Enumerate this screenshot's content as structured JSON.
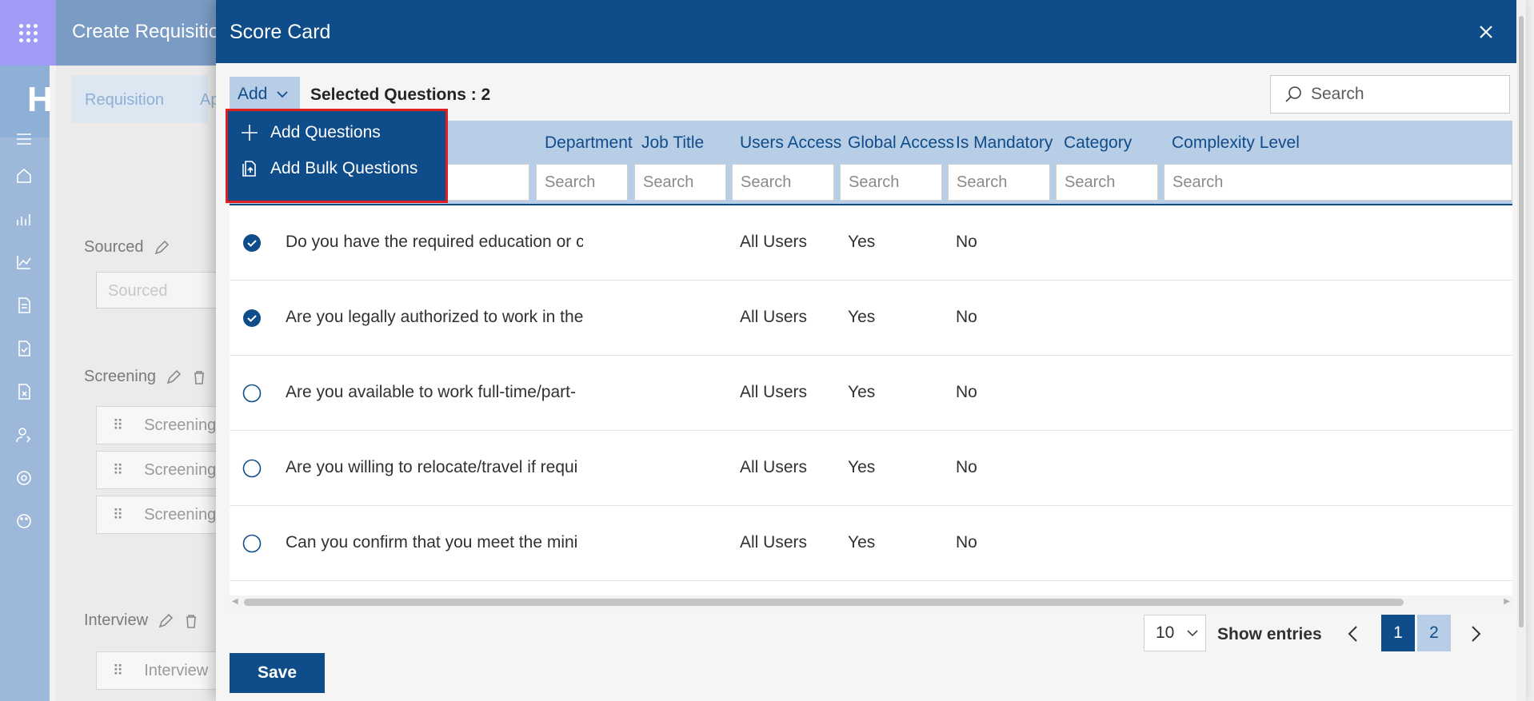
{
  "background": {
    "header_title": "Create Requisition",
    "brand_letter": "H",
    "tabs": [
      "Requisition",
      "Ap"
    ],
    "sections": {
      "sourced": {
        "label": "Sourced",
        "placeholder": "Sourced"
      },
      "screening": {
        "label": "Screening",
        "items": [
          "Screening",
          "Screening",
          "Screening"
        ]
      },
      "interview": {
        "label": "Interview",
        "items": [
          "Interview"
        ]
      }
    }
  },
  "dialog": {
    "title": "Score Card",
    "add_label": "Add",
    "selected_questions": "Selected Questions : 2",
    "search_placeholder": "Search",
    "add_menu": {
      "items": [
        {
          "label": "Add Questions",
          "icon": "plus-icon"
        },
        {
          "label": "Add Bulk Questions",
          "icon": "bulk-upload-icon"
        }
      ]
    },
    "columns": [
      {
        "label": "Department",
        "filter_placeholder": "Search"
      },
      {
        "label": "Job Title",
        "filter_placeholder": "Search"
      },
      {
        "label": "Users Access",
        "filter_placeholder": "Search"
      },
      {
        "label": "Global Access",
        "filter_placeholder": "Search"
      },
      {
        "label": "Is Mandatory",
        "filter_placeholder": "Search"
      },
      {
        "label": "Category",
        "filter_placeholder": "Search"
      },
      {
        "label": "Complexity Level",
        "filter_placeholder": "Search"
      }
    ],
    "rows": [
      {
        "question": "Do you have the required education or c",
        "users_access": "All Users",
        "global_access": "Yes",
        "is_mandatory": "No",
        "selected": true
      },
      {
        "question": "Are you legally authorized to work in the",
        "users_access": "All Users",
        "global_access": "Yes",
        "is_mandatory": "No",
        "selected": true
      },
      {
        "question": "Are you available to work full-time/part-",
        "users_access": "All Users",
        "global_access": "Yes",
        "is_mandatory": "No",
        "selected": false
      },
      {
        "question": "Are you willing to relocate/travel if requi",
        "users_access": "All Users",
        "global_access": "Yes",
        "is_mandatory": "No",
        "selected": false
      },
      {
        "question": "Can you confirm that you meet the mini",
        "users_access": "All Users",
        "global_access": "Yes",
        "is_mandatory": "No",
        "selected": false
      }
    ],
    "pagination": {
      "page_size": "10",
      "show_entries": "Show entries",
      "pages": [
        "1",
        "2"
      ],
      "current_page": "1"
    },
    "save_label": "Save"
  },
  "colors": {
    "primary": "#0f4c8a",
    "header_tint": "#b8cde6",
    "highlight_border": "#e02020"
  }
}
